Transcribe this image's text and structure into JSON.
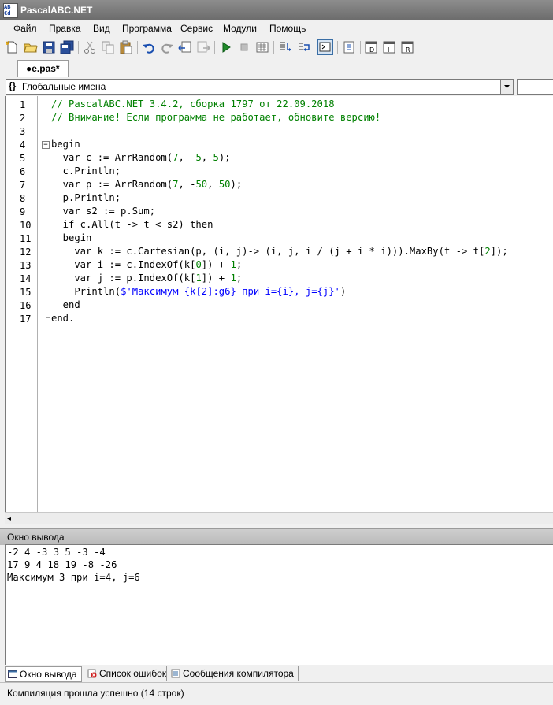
{
  "window": {
    "title": "PascalABC.NET"
  },
  "menu": [
    "Файл",
    "Правка",
    "Вид",
    "Программа",
    "Сервис",
    "Модули",
    "Помощь"
  ],
  "toolbar": {
    "icons": [
      "new-file-icon",
      "open-file-icon",
      "save-icon",
      "save-all-icon",
      "cut-icon",
      "copy-icon",
      "paste-icon",
      "undo-icon",
      "redo-icon",
      "navigate-back-icon",
      "navigate-forward-icon",
      "run-icon",
      "stop-icon",
      "compile-icon",
      "step-into-icon",
      "step-over-icon",
      "output-window-icon",
      "debug-window-icon",
      "form-designer-icon",
      "form-insert-icon",
      "form-tool-icon"
    ]
  },
  "editor_tab": {
    "label": "●e.pas*"
  },
  "names_combo": {
    "braces": "{}",
    "value": "Глобальные имена"
  },
  "code": {
    "line_numbers": [
      "1",
      "2",
      "3",
      "4",
      "5",
      "6",
      "7",
      "8",
      "9",
      "10",
      "11",
      "12",
      "13",
      "14",
      "15",
      "16",
      "17"
    ],
    "lines": [
      "// PascalABC.NET 3.4.2, сборка 1797 от 22.09.2018",
      "// Внимание! Если программа не работает, обновите версию!",
      "",
      "begin",
      "  var c := ArrRandom(7, -5, 5);",
      "  c.Println;",
      "  var p := ArrRandom(7, -50, 50);",
      "  p.Println;",
      "  var s2 := p.Sum;",
      "  if c.All(t -> t < s2) then",
      "  begin",
      "    var k := c.Cartesian(p, (i, j)-> (i, j, i / (j + i * i))).MaxBy(t -> t[2]);",
      "    var i := c.IndexOf(k[0]) + 1;",
      "    var j := p.IndexOf(k[1]) + 1;",
      "    Println($'Максимум {k[2]:g6} при i={i}, j={j}')",
      "  end",
      "end."
    ]
  },
  "output": {
    "header": "Окно вывода",
    "lines": [
      "-2 4 -3 3 5 -3 -4",
      "17 9 4 18 19 -8 -26",
      "Максимум 3 при i=4, j=6"
    ]
  },
  "bottom_tabs": [
    "Окно вывода",
    "Список ошибок",
    "Сообщения компилятора"
  ],
  "status": {
    "text": "Компиляция прошла успешно (14 строк)"
  },
  "colors": {
    "comment": "#008000",
    "string": "#0000ff",
    "keyword": "#000000"
  }
}
